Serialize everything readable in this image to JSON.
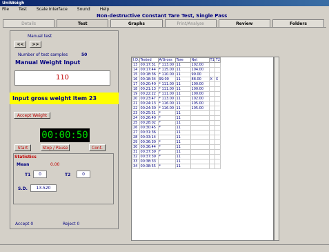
{
  "window": {
    "title": "UniWeigh"
  },
  "menu": [
    "File",
    "Test",
    "Scale Interface",
    "Sound",
    "Help"
  ],
  "heading": "Non-destructive Constant Tare Test, Single Pass",
  "tabs": [
    {
      "label": "Details",
      "state": "disabled"
    },
    {
      "label": "Test",
      "state": "active"
    },
    {
      "label": "Graphs",
      "state": "enabled"
    },
    {
      "label": "Print/Analyse",
      "state": "disabled"
    },
    {
      "label": "Review",
      "state": "enabled"
    },
    {
      "label": "Folders",
      "state": "enabled"
    }
  ],
  "test": {
    "manual_test_label": "Manual test",
    "prev_label": "<<",
    "next_label": ">>",
    "samples_label": "Number of test samples",
    "samples_value": "50",
    "manual_weight_label": "Manual Weight Input",
    "weight_value": "110",
    "prompt": "Input gross weight item 23",
    "accept_label": "Accept Weight",
    "timer": "00:00:50",
    "start_label": "Start",
    "stop_label": "Stop / Pause",
    "cont_label": "Cont.",
    "stats": {
      "title": "Statistics",
      "mean_label": "Mean",
      "mean_value": "0.00",
      "t1_label": "T1",
      "t1_value": "0",
      "t2_label": "T2",
      "t2_value": "0",
      "sd_label": "S.D.",
      "sd_value": "13.520"
    },
    "accept_text": "Accept  0",
    "reject_text": "Reject  0"
  },
  "grid": {
    "columns": [
      "I.D.",
      "Tested",
      "A/Gross",
      "Tare",
      "Net",
      "T1",
      "T2"
    ],
    "rows": [
      [
        "13",
        "00:17:31",
        "* 113.00",
        "11",
        "102.00",
        "",
        ""
      ],
      [
        "14",
        "00:17:44",
        "* 115.00",
        "11",
        "104.00",
        "",
        ""
      ],
      [
        "15",
        "00:18:36",
        "* 110.00",
        "11",
        "99.00",
        "",
        ""
      ],
      [
        "16",
        "00:18:34",
        "99.00",
        "11",
        "88.00",
        "X",
        "X"
      ],
      [
        "17",
        "00:20:40",
        "* 111.00",
        "11",
        "100.00",
        "",
        ""
      ],
      [
        "18",
        "00:21:13",
        "* 111.00",
        "11",
        "100.00",
        "",
        ""
      ],
      [
        "19",
        "00:22:22",
        "* 111.00",
        "11",
        "100.00",
        "",
        ""
      ],
      [
        "20",
        "00:23:47",
        "* 113.00",
        "11",
        "102.00",
        "",
        ""
      ],
      [
        "21",
        "00:24:13",
        "* 116.00",
        "11",
        "105.00",
        "",
        ""
      ],
      [
        "22",
        "00:24:30",
        "* 116.00",
        "11",
        "105.00",
        "",
        ""
      ],
      [
        "23",
        "00:25:51",
        "*",
        "11",
        "",
        "",
        ""
      ],
      [
        "24",
        "00:26:40",
        "*",
        "11",
        "",
        "",
        ""
      ],
      [
        "25",
        "00:28:02",
        "*",
        "11",
        "",
        "",
        ""
      ],
      [
        "26",
        "00:30:45",
        "*",
        "11",
        "",
        "",
        ""
      ],
      [
        "27",
        "00:31:36",
        "",
        "11",
        "",
        "",
        ""
      ],
      [
        "28",
        "00:33:14",
        "",
        "11",
        "",
        "",
        ""
      ],
      [
        "29",
        "00:36:30",
        "*",
        "11",
        "",
        "",
        ""
      ],
      [
        "30",
        "00:36:44",
        "*",
        "11",
        "",
        "",
        ""
      ],
      [
        "31",
        "00:37:39",
        "*",
        "11",
        "",
        "",
        ""
      ],
      [
        "32",
        "00:37:39",
        "*",
        "11",
        "",
        "",
        ""
      ],
      [
        "33",
        "00:38:33",
        "",
        "11",
        "",
        "",
        ""
      ],
      [
        "34",
        "00:38:55",
        "*",
        "11",
        "",
        "",
        ""
      ]
    ]
  }
}
